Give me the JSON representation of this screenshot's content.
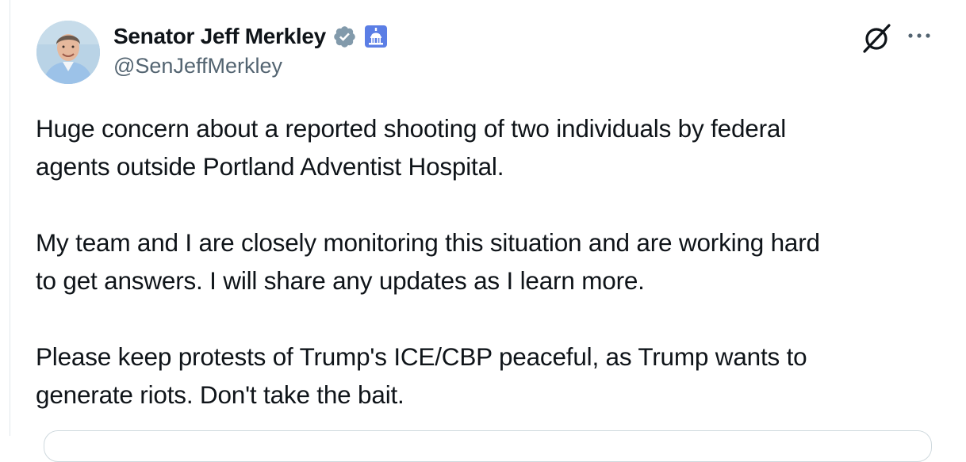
{
  "author": {
    "display_name": "Senator Jeff Merkley",
    "handle": "@SenJeffMerkley",
    "verified_badge_color": "#829aab"
  },
  "actions": {
    "grok_icon": "grok-icon",
    "more_icon": "more-icon"
  },
  "tweet": {
    "paragraphs": [
      {
        "line1": "Huge concern about a reported shooting of two individuals by federal",
        "line2": "agents outside Portland Adventist Hospital."
      },
      {
        "line1": "My team and I are closely monitoring this situation and are working hard",
        "line2": "to get answers. I will share any updates as I learn more."
      },
      {
        "line1": "Please keep protests of Trump's ICE/CBP peaceful, as Trump wants to",
        "line2": "generate riots. Don't take the bait."
      }
    ]
  },
  "colors": {
    "text": "#0f1419",
    "secondary": "#536471",
    "border": "#cfd9de"
  }
}
